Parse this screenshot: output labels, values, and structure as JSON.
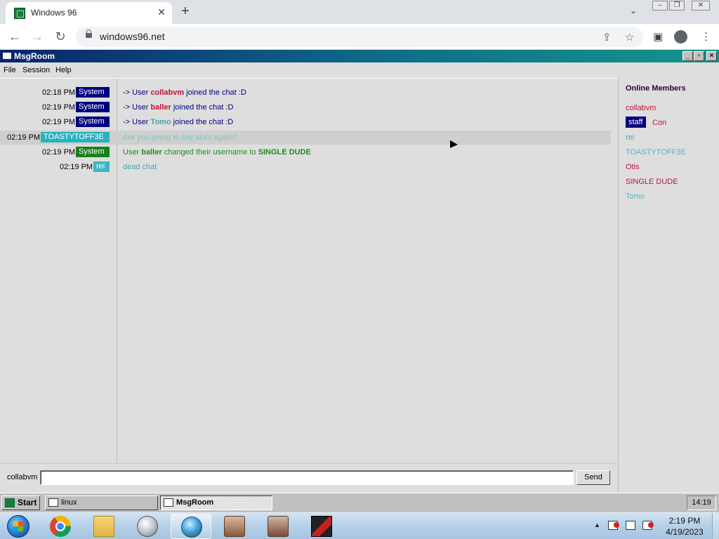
{
  "browser": {
    "tab_title": "Windows 96",
    "tab_close": "✕",
    "new_tab": "+",
    "url": "windows96.net"
  },
  "msgroom": {
    "window_title": "MsgRoom",
    "menu": [
      "File",
      "Session",
      "Help"
    ],
    "messages": [
      {
        "time": "02:18 PM",
        "badge": "System",
        "prefix": "-> User ",
        "user": "collabvm",
        "suffix": " joined the chat :D"
      },
      {
        "time": "02:19 PM",
        "badge": "System",
        "prefix": "-> User ",
        "user": "baller",
        "suffix": " joined the chat :D"
      },
      {
        "time": "02:19 PM",
        "badge": "System",
        "prefix": "-> User ",
        "user": "Tomo",
        "suffix": " joined the chat :D"
      },
      {
        "time": "02:19 PM",
        "badge": "TOASTYTOFF3E",
        "text": "Are you going to say slurs again?"
      },
      {
        "time": "02:19 PM",
        "badge": "System",
        "prefix": "User ",
        "user": "baller",
        "mid": " changed their username to ",
        "newname": "SINGLE DUDE"
      },
      {
        "time": "02:19 PM",
        "badge": "rei",
        "text": "dead chat"
      }
    ],
    "members_header": "Online Members",
    "members": [
      {
        "name": "collabvm"
      },
      {
        "badge": "staff",
        "name": "Con"
      },
      {
        "name": "rei"
      },
      {
        "name": "TOASTYTOFF3E"
      },
      {
        "name": "Otis"
      },
      {
        "name": "SINGLE DUDE"
      },
      {
        "name": "Tomo"
      }
    ],
    "input_label": "collabvm",
    "input_value": "",
    "send_label": "Send"
  },
  "w96_taskbar": {
    "start_label": "Start",
    "items": [
      {
        "label": "linux"
      },
      {
        "label": "MsgRoom"
      }
    ],
    "clock": "14:19"
  },
  "win7_taskbar": {
    "time": "2:19 PM",
    "date": "4/19/2023",
    "tray_up": "▲"
  },
  "colors": {
    "title_gradient_start": "#0a246a",
    "title_gradient_end": "#16958a",
    "system_badge": "#000080",
    "system_badge_green": "#18801a",
    "user_crimson": "#c0143c",
    "user_teal": "#4aa5a8"
  }
}
